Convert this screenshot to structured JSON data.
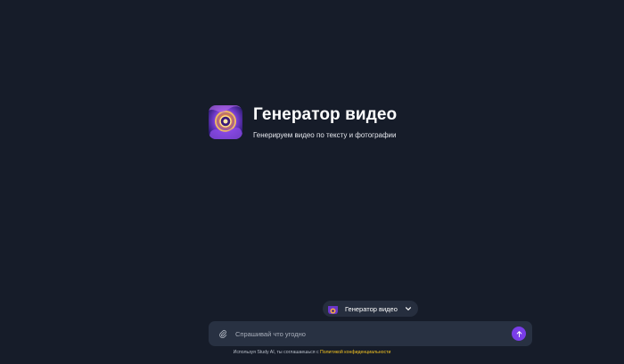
{
  "hero": {
    "title": "Генератор видео",
    "subtitle": "Генерируем видео по тексту и фотографии",
    "logo_icon": "video-generator-logo"
  },
  "mode_selector": {
    "label": "Генератор видео",
    "icon": "chevron-down-icon"
  },
  "input": {
    "placeholder": "Спрашивай что угодно",
    "value": "",
    "attach_icon": "paperclip-icon",
    "send_icon": "arrow-up-icon"
  },
  "footer": {
    "text": "Используя Study AI, ты соглашаешься с",
    "link": "Политикой конфиденциальности"
  },
  "colors": {
    "background": "#161c29",
    "surface": "#283142",
    "accent": "#7a3de8",
    "link": "#f3c322"
  }
}
